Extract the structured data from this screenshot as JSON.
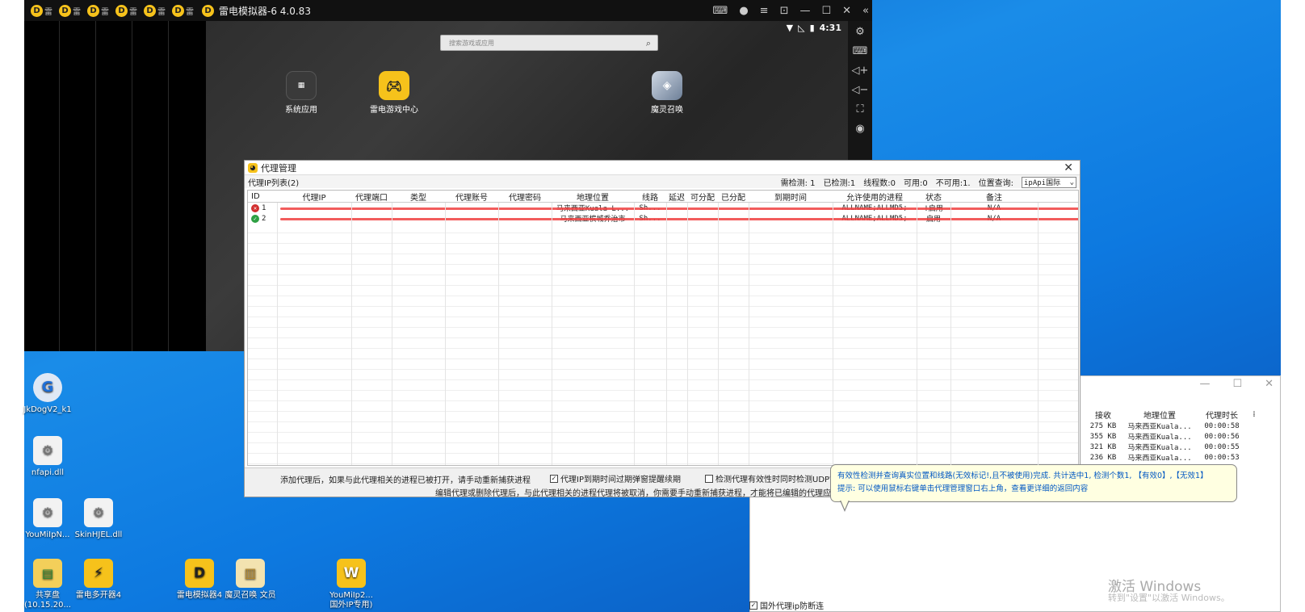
{
  "emulator": {
    "title": "雷电模拟器-6 4.0.83",
    "tabs": [
      "雷",
      "雷",
      "雷",
      "雷",
      "雷",
      "雷"
    ],
    "tab_logo": "D",
    "clock": "4:31",
    "search_placeholder": "搜索游戏或应用",
    "apps": [
      {
        "label": "系统应用",
        "icon": "system-apps-icon"
      },
      {
        "label": "雷电游戏中心",
        "icon": "gamepad-icon"
      },
      {
        "label": "魔灵召唤",
        "icon": "game-character-icon"
      }
    ]
  },
  "desktop": {
    "icons": [
      {
        "label": "JkDogV2_k1"
      },
      {
        "label": "nfapi.dll"
      },
      {
        "label": "YouMiIpN..."
      },
      {
        "label": "SkinHJEL.dll"
      },
      {
        "label": "共享盘 (10.15.20..."
      },
      {
        "label": "雷电多开器4"
      },
      {
        "label": "雷电模拟器4"
      },
      {
        "label": "魔灵召唤 文员"
      },
      {
        "label": "YouMiIp2... 国外IP专用)"
      }
    ]
  },
  "proxy_manager": {
    "title": "代理管理",
    "list_label": "代理IP列表(2)",
    "stats": {
      "need_check": "需检测: 1",
      "checked": "已检测:1",
      "threads": "线程数:0",
      "available": "可用:0",
      "unavailable": "不可用:1.",
      "location_query": "位置查询:",
      "location_source": "ipApi国际"
    },
    "columns": [
      "ID",
      "代理IP",
      "代理端口",
      "类型",
      "代理账号",
      "代理密码",
      "地理位置",
      "线路",
      "延迟",
      "可分配",
      "已分配",
      "到期时间",
      "允许使用的进程",
      "状态",
      "备注"
    ],
    "rows": [
      {
        "id": "1",
        "ok": false,
        "ip": "",
        "port": "",
        "type": "",
        "account": "",
        "password": "",
        "location": "马来西亚Kuala L...",
        "line": "Sh...",
        "latency": "",
        "assignable": "",
        "assigned": "",
        "expiry": "",
        "processes": "ALLNAME;ALLMD5;",
        "status": "!启用",
        "note": "N/A"
      },
      {
        "id": "2",
        "ok": true,
        "ip": "",
        "port": "",
        "type": "",
        "account": "",
        "password": "",
        "location": "马来西亚槟城乔治市",
        "line": "Sh...",
        "latency": "",
        "assignable": "",
        "assigned": "",
        "expiry": "",
        "processes": "ALLNAME;ALLMD5;",
        "status": "启用",
        "note": "N/A"
      }
    ],
    "footer": {
      "note1": "添加代理后，如果与此代理相关的进程已被打开，请手动重新捕获进程",
      "check1_label": "代理IP到期时间过期弹窗提醒续期",
      "check2_label": "检测代理有效性时同时检测UDP协",
      "note2": "编辑代理或删除代理后，与此代理相关的进程代理将被取消，你需要手动重新捕获进程，才能将已编辑的代理应用"
    }
  },
  "tooltip": {
    "line1_prefix": "有效性检测并查询真实位置和线路(无效标记!,且不被使用)完成. 共计选中1, 检测个数1, ",
    "line1_valid": "【有效0】",
    "line1_sep": ",",
    "line1_invalid": "【无效1】",
    "line2": "提示: 可以使用鼠标右键单击代理管理窗口右上角，查看更详细的返回内容"
  },
  "secondary_window": {
    "columns": [
      "接收",
      "地理位置",
      "代理时长"
    ],
    "rows": [
      {
        "recv": "275 KB",
        "loc": "马来西亚Kuala...",
        "dur": "00:00:58"
      },
      {
        "recv": "355 KB",
        "loc": "马来西亚Kuala...",
        "dur": "00:00:56"
      },
      {
        "recv": "321 KB",
        "loc": "马来西亚Kuala...",
        "dur": "00:00:55"
      },
      {
        "recv": "236 KB",
        "loc": "马来西亚Kuala...",
        "dur": "00:00:53"
      }
    ],
    "checkbox_label": "国外代理ip防断连",
    "watermark_title": "激活 Windows",
    "watermark_sub": "转到\"设置\"以激活 Windows。"
  }
}
